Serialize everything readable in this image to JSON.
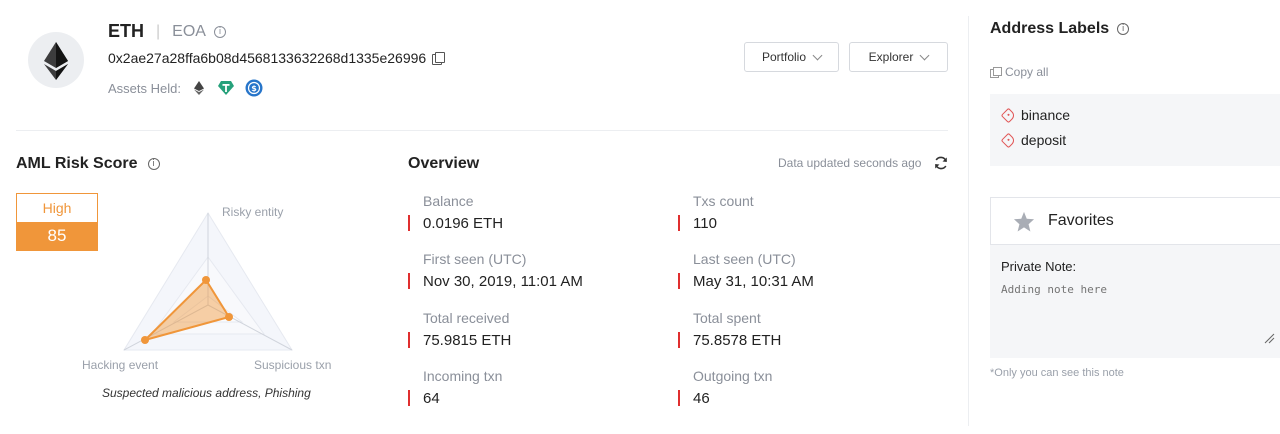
{
  "header": {
    "chain": "ETH",
    "separator": "|",
    "account_type": "EOA",
    "address": "0x2ae27a28ffa6b08d4568133632268d1335e26996",
    "assets_held_label": "Assets Held:",
    "assets": [
      "eth-icon",
      "usdt-icon",
      "usdc-icon"
    ],
    "portfolio_button": "Portfolio",
    "explorer_button": "Explorer"
  },
  "aml": {
    "title": "AML Risk Score",
    "level": "High",
    "score": "85",
    "axes": [
      "Risky entity",
      "Hacking event",
      "Suspicious txn"
    ],
    "caption": "Suspected malicious address, Phishing",
    "risk_values": {
      "risky_entity": 0.3,
      "hacking_event": 0.75,
      "suspicious_txn": 0.25
    },
    "accent_color": "#f0963a"
  },
  "overview": {
    "title": "Overview",
    "updated": "Data updated seconds ago",
    "stats_left": [
      {
        "label": "Balance",
        "value": "0.0196 ETH"
      },
      {
        "label": "First seen (UTC)",
        "value": "Nov 30, 2019, 11:01 AM"
      },
      {
        "label": "Total received",
        "value": "75.9815 ETH"
      },
      {
        "label": "Incoming txn",
        "value": "64"
      }
    ],
    "stats_right": [
      {
        "label": "Txs count",
        "value": "110"
      },
      {
        "label": "Last seen (UTC)",
        "value": "May 31, 10:31 AM"
      },
      {
        "label": "Total spent",
        "value": "75.8578 ETH"
      },
      {
        "label": "Outgoing txn",
        "value": "46"
      }
    ]
  },
  "labels": {
    "title": "Address Labels",
    "copy_all": "Copy all",
    "items": [
      "binance",
      "deposit"
    ]
  },
  "favorites": {
    "title": "Favorites",
    "note_label": "Private Note:",
    "note_placeholder": "Adding note here",
    "note_hint": "*Only you can see this note"
  }
}
